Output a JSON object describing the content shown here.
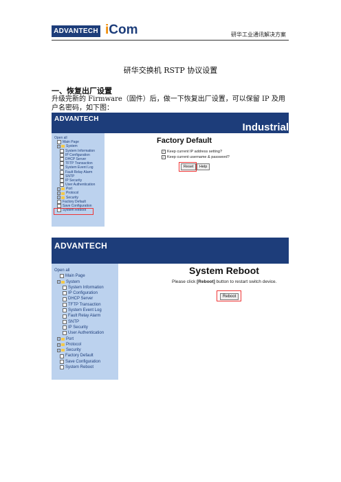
{
  "header": {
    "brand": "ADVANTECH",
    "icom_i": "i",
    "icom_rest": "Com",
    "right_text": "研华工业通讯解决方案"
  },
  "doc": {
    "title": "研华交换机 RSTP 协议设置",
    "section": "一、恢复出厂设置",
    "paragraph": "升级完新的 Firmware（固件）后，做一下恢复出厂设置，可以保留 IP 及用户名密码，如下图："
  },
  "shot1": {
    "brand": "ADVANTECH",
    "industrial": "Industrial",
    "page_title": "Factory Default",
    "check1": "Keep current IP address setting?",
    "check2": "Keep current username & password?",
    "reset": "Reset",
    "help": "Help",
    "tree": [
      {
        "label": "Open all",
        "icon": "none",
        "indent": 0
      },
      {
        "label": "Main Page",
        "icon": "page",
        "indent": 1
      },
      {
        "label": "System",
        "icon": "folder",
        "indent": 1
      },
      {
        "label": "System Information",
        "icon": "page",
        "indent": 2
      },
      {
        "label": "IP Configuration",
        "icon": "page",
        "indent": 2
      },
      {
        "label": "DHCP Server",
        "icon": "page",
        "indent": 2
      },
      {
        "label": "TFTP Transaction",
        "icon": "page",
        "indent": 2
      },
      {
        "label": "System Event Log",
        "icon": "page",
        "indent": 2
      },
      {
        "label": "Fault Relay Alarm",
        "icon": "page",
        "indent": 2
      },
      {
        "label": "SNTP",
        "icon": "page",
        "indent": 2
      },
      {
        "label": "IP Security",
        "icon": "page",
        "indent": 2
      },
      {
        "label": "User Authentication",
        "icon": "page",
        "indent": 2
      },
      {
        "label": "Port",
        "icon": "folder",
        "indent": 1
      },
      {
        "label": "Protocol",
        "icon": "folder",
        "indent": 1
      },
      {
        "label": "Security",
        "icon": "folder",
        "indent": 1
      },
      {
        "label": "Factory Default",
        "icon": "page",
        "indent": 1
      },
      {
        "label": "Save Configuration",
        "icon": "page",
        "indent": 1
      },
      {
        "label": "System Reboot",
        "icon": "page",
        "indent": 1
      }
    ]
  },
  "shot2": {
    "brand": "ADVANTECH",
    "page_title": "System Reboot",
    "text_pre": "Please click ",
    "text_bold": "[Reboot]",
    "text_post": " button to restart switch device.",
    "reboot": "Reboot",
    "tree": [
      {
        "label": "Open all",
        "icon": "none",
        "indent": 0
      },
      {
        "label": "Main Page",
        "icon": "page",
        "indent": 2
      },
      {
        "label": "System",
        "icon": "folder",
        "indent": 1
      },
      {
        "label": "System Information",
        "icon": "page",
        "indent": 3
      },
      {
        "label": "IP Configuration",
        "icon": "page",
        "indent": 3
      },
      {
        "label": "DHCP Server",
        "icon": "page",
        "indent": 3
      },
      {
        "label": "TFTP Transaction",
        "icon": "page",
        "indent": 3
      },
      {
        "label": "System Event Log",
        "icon": "page",
        "indent": 3
      },
      {
        "label": "Fault Relay Alarm",
        "icon": "page",
        "indent": 3
      },
      {
        "label": "SNTP",
        "icon": "page",
        "indent": 3
      },
      {
        "label": "IP Security",
        "icon": "page",
        "indent": 3
      },
      {
        "label": "User Authentication",
        "icon": "page",
        "indent": 3
      },
      {
        "label": "Port",
        "icon": "folder",
        "indent": 1
      },
      {
        "label": "Protocol",
        "icon": "folder",
        "indent": 1
      },
      {
        "label": "Security",
        "icon": "folder",
        "indent": 1
      },
      {
        "label": "Factory Default",
        "icon": "page",
        "indent": 2
      },
      {
        "label": "Save Configuration",
        "icon": "page",
        "indent": 2
      },
      {
        "label": "System Reboot",
        "icon": "page",
        "indent": 2
      }
    ]
  },
  "colors": {
    "brand_navy": "#1d3d7a",
    "sidebar": "#bcd2ee",
    "highlight": "#e33333",
    "icom_accent": "#f08a00"
  }
}
